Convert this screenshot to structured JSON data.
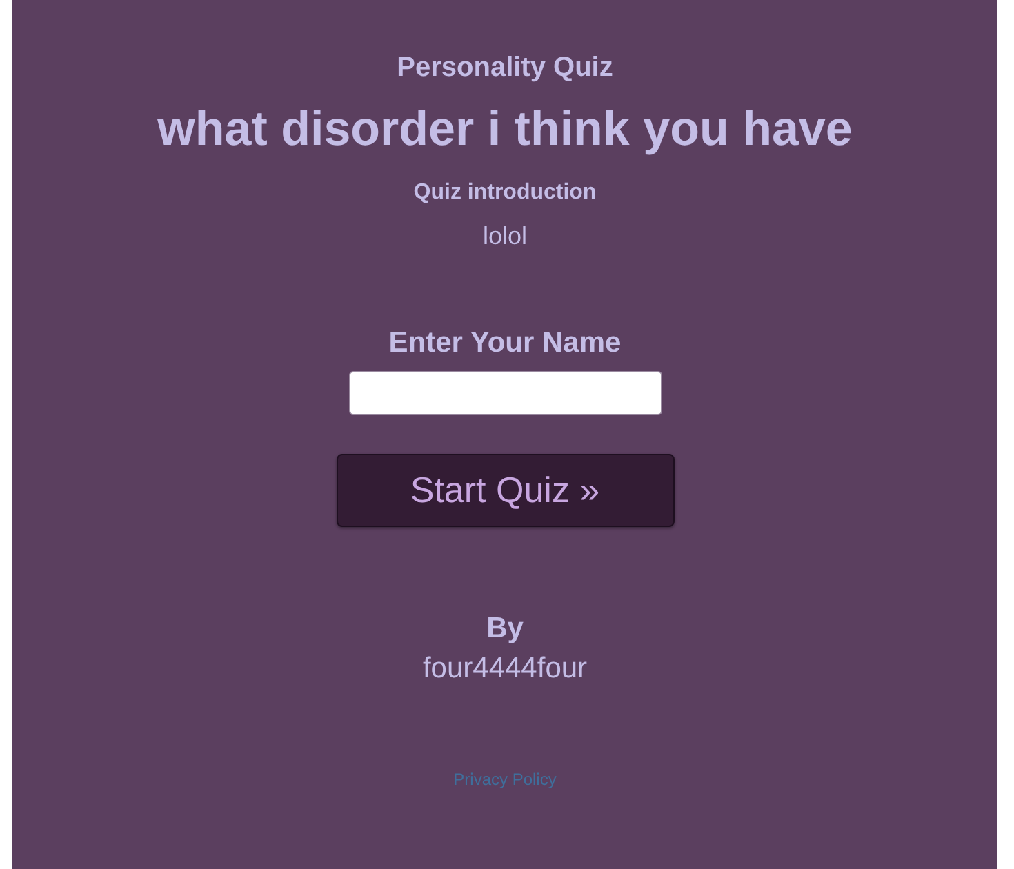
{
  "header": "Personality Quiz",
  "title": "what disorder i think you have",
  "intro_heading": "Quiz introduction",
  "intro_text": "lolol",
  "name_label": "Enter Your Name",
  "start_button": "Start Quiz »",
  "by_label": "By",
  "author": "four4444four",
  "footer_link": "Privacy Policy"
}
